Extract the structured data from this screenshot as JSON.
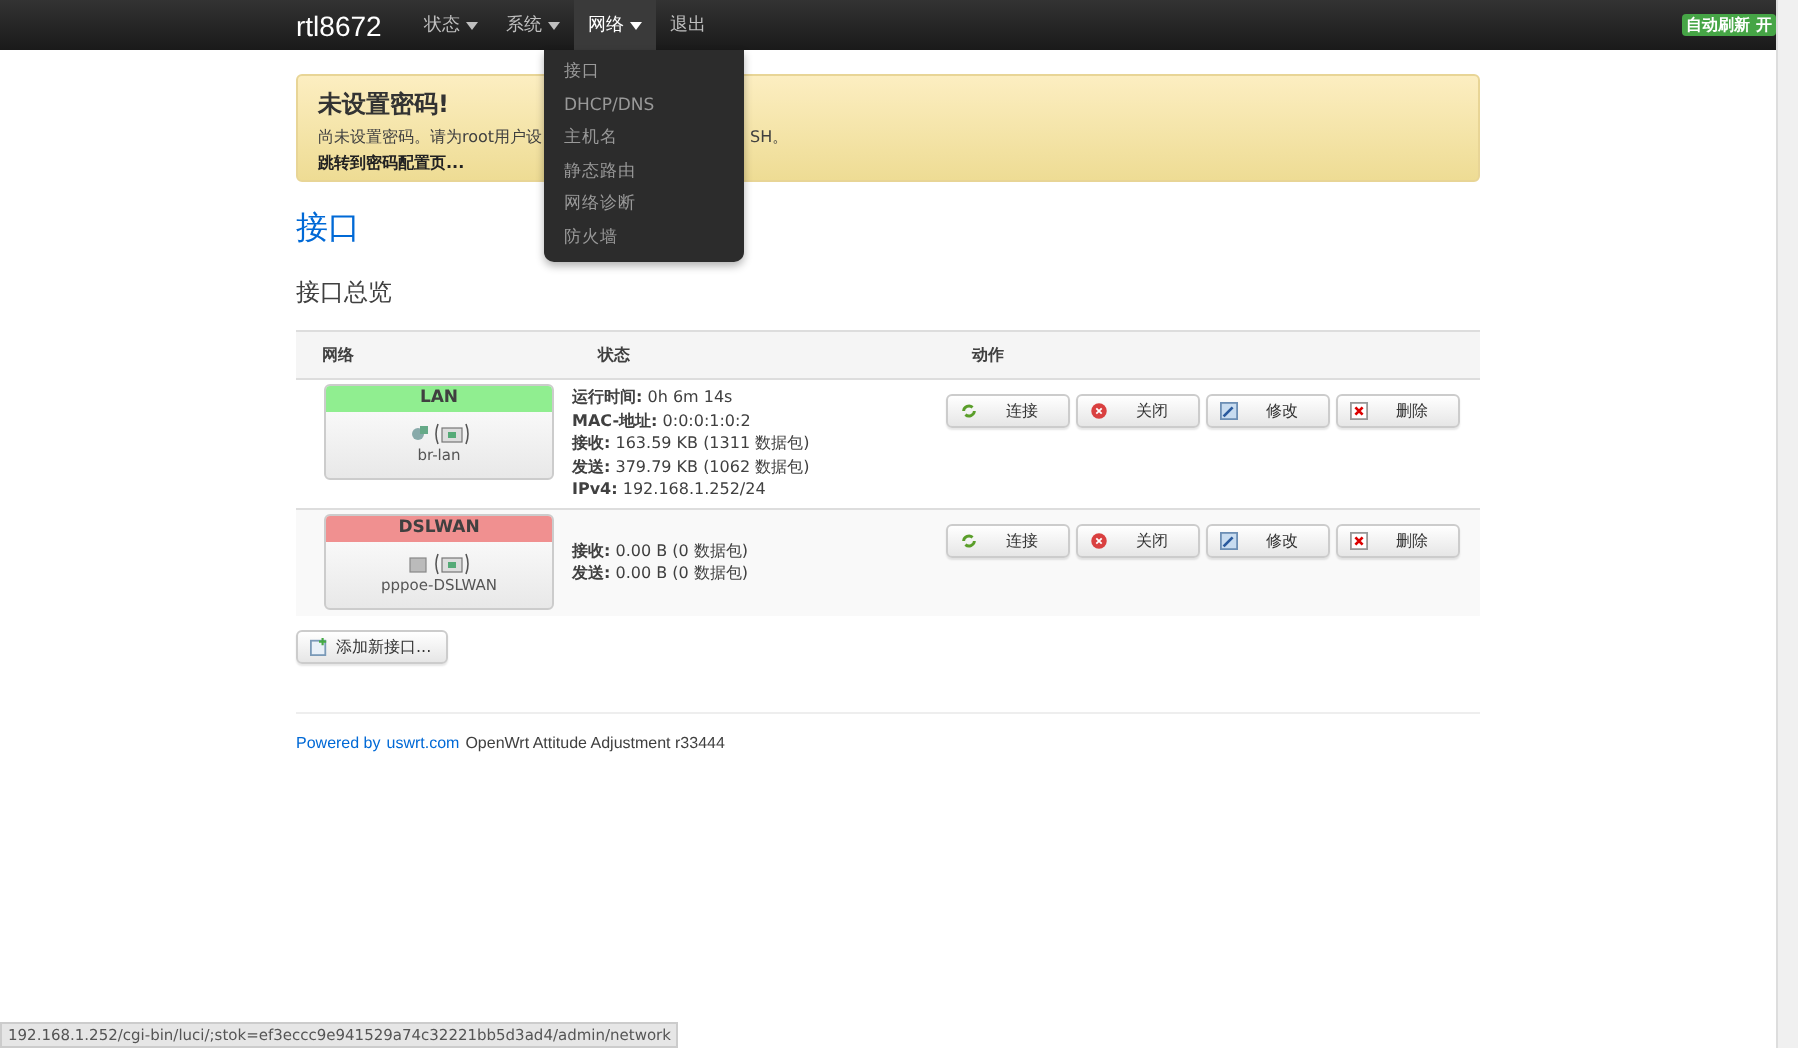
{
  "navbar": {
    "brand": "rtl8672",
    "menus": [
      {
        "label": "状态",
        "has_caret": true,
        "selected": false
      },
      {
        "label": "系统",
        "has_caret": true,
        "selected": false
      },
      {
        "label": "网络",
        "has_caret": true,
        "selected": true
      },
      {
        "label": "退出",
        "has_caret": false,
        "selected": false
      }
    ],
    "dropdown": [
      "接口",
      "DHCP/DNS",
      "主机名",
      "静态路由",
      "网络诊断",
      "防火墙"
    ],
    "auto_refresh": "自动刷新 开"
  },
  "alert": {
    "title": "未设置密码!",
    "text_before": "尚未设置密码。请为root用户设",
    "text_after": "SH。",
    "link": "跳转到密码配置页..."
  },
  "page_title": "接口",
  "section_title": "接口总览",
  "table": {
    "columns": [
      "网络",
      "状态",
      "动作"
    ],
    "rows": [
      {
        "name": "LAN",
        "color": "#90ee90",
        "kind": "bridge",
        "device": "br-lan",
        "status": [
          {
            "label": "运行时间:",
            "value": "0h 6m 14s"
          },
          {
            "label": "MAC-地址:",
            "value": "0:0:0:1:0:2"
          },
          {
            "label": "接收:",
            "value": "163.59 KB (1311 数据包)"
          },
          {
            "label": "发送:",
            "value": "379.79 KB (1062 数据包)"
          },
          {
            "label": "IPv4:",
            "value": "192.168.1.252/24"
          }
        ],
        "actions": [
          {
            "kind": "connect",
            "label": "连接"
          },
          {
            "kind": "stop",
            "label": "关闭"
          },
          {
            "kind": "edit",
            "label": "修改"
          },
          {
            "kind": "delete",
            "label": "删除"
          }
        ]
      },
      {
        "name": "DSLWAN",
        "color": "#f09090",
        "kind": "ethernet",
        "device": "pppoe-DSLWAN",
        "status": [
          {
            "label": "接收:",
            "value": "0.00 B (0 数据包)"
          },
          {
            "label": "发送:",
            "value": "0.00 B (0 数据包)"
          }
        ],
        "actions": [
          {
            "kind": "connect",
            "label": "连接"
          },
          {
            "kind": "stop",
            "label": "关闭"
          },
          {
            "kind": "edit",
            "label": "修改"
          },
          {
            "kind": "delete",
            "label": "删除"
          }
        ]
      }
    ]
  },
  "add_button": "添加新接口...",
  "footer": {
    "prefix": "Powered by",
    "link": "uswrt.com",
    "text": "OpenWrt Attitude Adjustment r33444"
  },
  "status_url": "192.168.1.252/cgi-bin/luci/;stok=ef3eccc9e941529a74c32221bb5d3ad4/admin/network"
}
